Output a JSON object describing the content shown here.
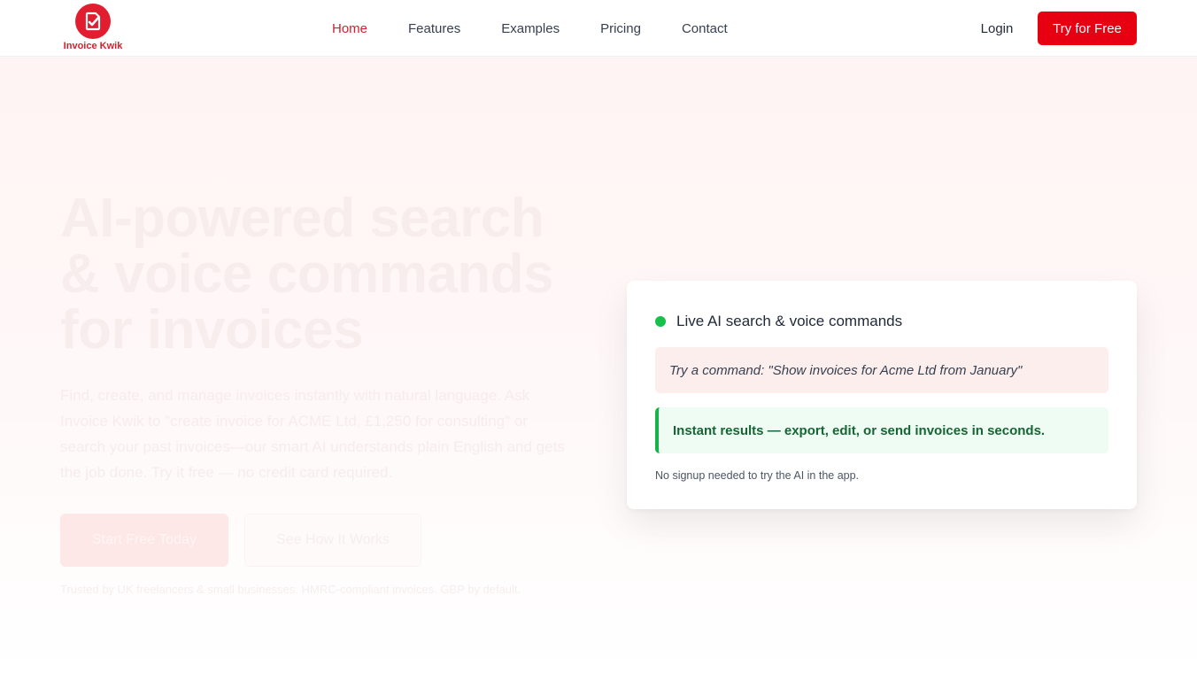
{
  "brand": {
    "name": "Invoice Kwik",
    "accent_color": "#e60012",
    "logo_icon": "check-document-icon"
  },
  "nav": {
    "items": [
      {
        "label": "Home",
        "active": true
      },
      {
        "label": "Features",
        "active": false
      },
      {
        "label": "Examples",
        "active": false
      },
      {
        "label": "Pricing",
        "active": false
      },
      {
        "label": "Contact",
        "active": false
      }
    ],
    "login_label": "Login",
    "cta_label": "Try for Free"
  },
  "hero": {
    "headline": "AI-powered search & voice commands for invoices",
    "subtext": "Find, create, and manage invoices instantly with natural language. Ask Invoice Kwik to \"create invoice for ACME Ltd, £1,250 for consulting\" or search your past invoices—our smart AI understands plain English and gets the job done. Try it free — no credit card required.",
    "primary_button": "Start Free Today",
    "secondary_button": "See How It Works",
    "trust_text": "Trusted by UK freelancers & small businesses. HMRC-compliant invoices. GBP by default."
  },
  "demo_card": {
    "status_color": "#16c04b",
    "title": "Live AI search & voice commands",
    "command_text": "Try a command: \"Show invoices for Acme Ltd from January\"",
    "result_text": "Instant results — export, edit, or send invoices in seconds.",
    "note": "No signup needed to try the AI in the app."
  }
}
